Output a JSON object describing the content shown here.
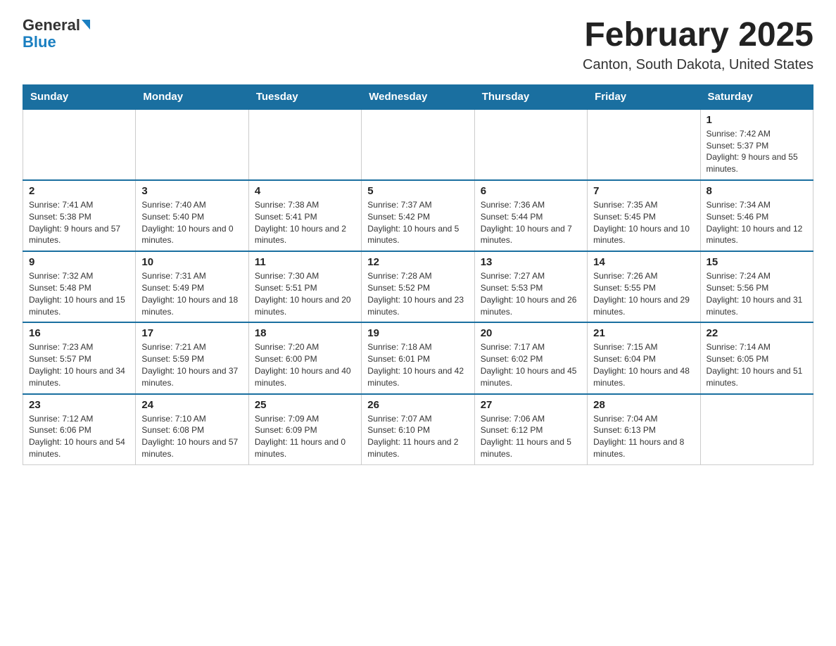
{
  "logo": {
    "top": "General",
    "bottom": "Blue"
  },
  "title": "February 2025",
  "subtitle": "Canton, South Dakota, United States",
  "days_of_week": [
    "Sunday",
    "Monday",
    "Tuesday",
    "Wednesday",
    "Thursday",
    "Friday",
    "Saturday"
  ],
  "weeks": [
    [
      {
        "day": "",
        "info": ""
      },
      {
        "day": "",
        "info": ""
      },
      {
        "day": "",
        "info": ""
      },
      {
        "day": "",
        "info": ""
      },
      {
        "day": "",
        "info": ""
      },
      {
        "day": "",
        "info": ""
      },
      {
        "day": "1",
        "info": "Sunrise: 7:42 AM\nSunset: 5:37 PM\nDaylight: 9 hours and 55 minutes."
      }
    ],
    [
      {
        "day": "2",
        "info": "Sunrise: 7:41 AM\nSunset: 5:38 PM\nDaylight: 9 hours and 57 minutes."
      },
      {
        "day": "3",
        "info": "Sunrise: 7:40 AM\nSunset: 5:40 PM\nDaylight: 10 hours and 0 minutes."
      },
      {
        "day": "4",
        "info": "Sunrise: 7:38 AM\nSunset: 5:41 PM\nDaylight: 10 hours and 2 minutes."
      },
      {
        "day": "5",
        "info": "Sunrise: 7:37 AM\nSunset: 5:42 PM\nDaylight: 10 hours and 5 minutes."
      },
      {
        "day": "6",
        "info": "Sunrise: 7:36 AM\nSunset: 5:44 PM\nDaylight: 10 hours and 7 minutes."
      },
      {
        "day": "7",
        "info": "Sunrise: 7:35 AM\nSunset: 5:45 PM\nDaylight: 10 hours and 10 minutes."
      },
      {
        "day": "8",
        "info": "Sunrise: 7:34 AM\nSunset: 5:46 PM\nDaylight: 10 hours and 12 minutes."
      }
    ],
    [
      {
        "day": "9",
        "info": "Sunrise: 7:32 AM\nSunset: 5:48 PM\nDaylight: 10 hours and 15 minutes."
      },
      {
        "day": "10",
        "info": "Sunrise: 7:31 AM\nSunset: 5:49 PM\nDaylight: 10 hours and 18 minutes."
      },
      {
        "day": "11",
        "info": "Sunrise: 7:30 AM\nSunset: 5:51 PM\nDaylight: 10 hours and 20 minutes."
      },
      {
        "day": "12",
        "info": "Sunrise: 7:28 AM\nSunset: 5:52 PM\nDaylight: 10 hours and 23 minutes."
      },
      {
        "day": "13",
        "info": "Sunrise: 7:27 AM\nSunset: 5:53 PM\nDaylight: 10 hours and 26 minutes."
      },
      {
        "day": "14",
        "info": "Sunrise: 7:26 AM\nSunset: 5:55 PM\nDaylight: 10 hours and 29 minutes."
      },
      {
        "day": "15",
        "info": "Sunrise: 7:24 AM\nSunset: 5:56 PM\nDaylight: 10 hours and 31 minutes."
      }
    ],
    [
      {
        "day": "16",
        "info": "Sunrise: 7:23 AM\nSunset: 5:57 PM\nDaylight: 10 hours and 34 minutes."
      },
      {
        "day": "17",
        "info": "Sunrise: 7:21 AM\nSunset: 5:59 PM\nDaylight: 10 hours and 37 minutes."
      },
      {
        "day": "18",
        "info": "Sunrise: 7:20 AM\nSunset: 6:00 PM\nDaylight: 10 hours and 40 minutes."
      },
      {
        "day": "19",
        "info": "Sunrise: 7:18 AM\nSunset: 6:01 PM\nDaylight: 10 hours and 42 minutes."
      },
      {
        "day": "20",
        "info": "Sunrise: 7:17 AM\nSunset: 6:02 PM\nDaylight: 10 hours and 45 minutes."
      },
      {
        "day": "21",
        "info": "Sunrise: 7:15 AM\nSunset: 6:04 PM\nDaylight: 10 hours and 48 minutes."
      },
      {
        "day": "22",
        "info": "Sunrise: 7:14 AM\nSunset: 6:05 PM\nDaylight: 10 hours and 51 minutes."
      }
    ],
    [
      {
        "day": "23",
        "info": "Sunrise: 7:12 AM\nSunset: 6:06 PM\nDaylight: 10 hours and 54 minutes."
      },
      {
        "day": "24",
        "info": "Sunrise: 7:10 AM\nSunset: 6:08 PM\nDaylight: 10 hours and 57 minutes."
      },
      {
        "day": "25",
        "info": "Sunrise: 7:09 AM\nSunset: 6:09 PM\nDaylight: 11 hours and 0 minutes."
      },
      {
        "day": "26",
        "info": "Sunrise: 7:07 AM\nSunset: 6:10 PM\nDaylight: 11 hours and 2 minutes."
      },
      {
        "day": "27",
        "info": "Sunrise: 7:06 AM\nSunset: 6:12 PM\nDaylight: 11 hours and 5 minutes."
      },
      {
        "day": "28",
        "info": "Sunrise: 7:04 AM\nSunset: 6:13 PM\nDaylight: 11 hours and 8 minutes."
      },
      {
        "day": "",
        "info": ""
      }
    ]
  ]
}
